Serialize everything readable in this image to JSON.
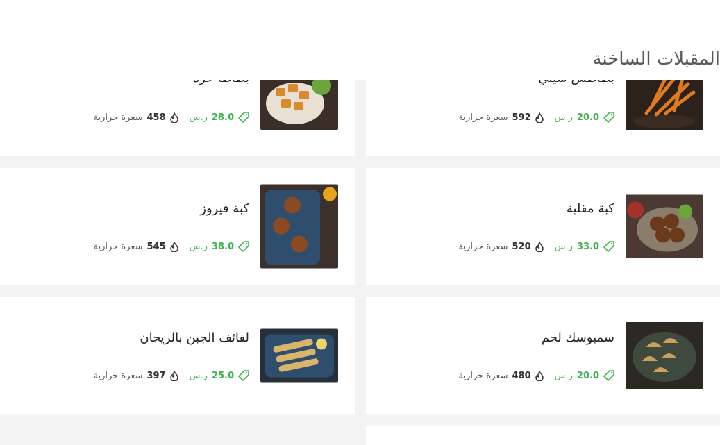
{
  "section": {
    "title": "المقبلات الساخنة"
  },
  "cards": [
    {
      "name": "بطاطس شيلي",
      "price": "20.0",
      "currency": "ر.س",
      "calories": "592",
      "calories_label": "سعرة حرارية"
    },
    {
      "name": "بطاطا حرة",
      "price": "28.0",
      "currency": "ر.س",
      "calories": "458",
      "calories_label": "سعرة حرارية"
    },
    {
      "name": "كبة مقلية",
      "price": "33.0",
      "currency": "ر.س",
      "calories": "520",
      "calories_label": "سعرة حرارية"
    },
    {
      "name": "كبة فيروز",
      "price": "38.0",
      "currency": "ر.س",
      "calories": "545",
      "calories_label": "سعرة حرارية"
    },
    {
      "name": "سمبوسك لحم",
      "price": "20.0",
      "currency": "ر.س",
      "calories": "480",
      "calories_label": "سعرة حرارية"
    },
    {
      "name": "لفائف الجبن بالريحان",
      "price": "25.0",
      "currency": "ر.س",
      "calories": "397",
      "calories_label": "سعرة حرارية"
    }
  ],
  "icons": {
    "price": "price-tag-icon",
    "calories": "flame-icon"
  },
  "colors": {
    "price": "#3fb34f",
    "card": "#ffffff",
    "background": "#f3f3f3"
  }
}
